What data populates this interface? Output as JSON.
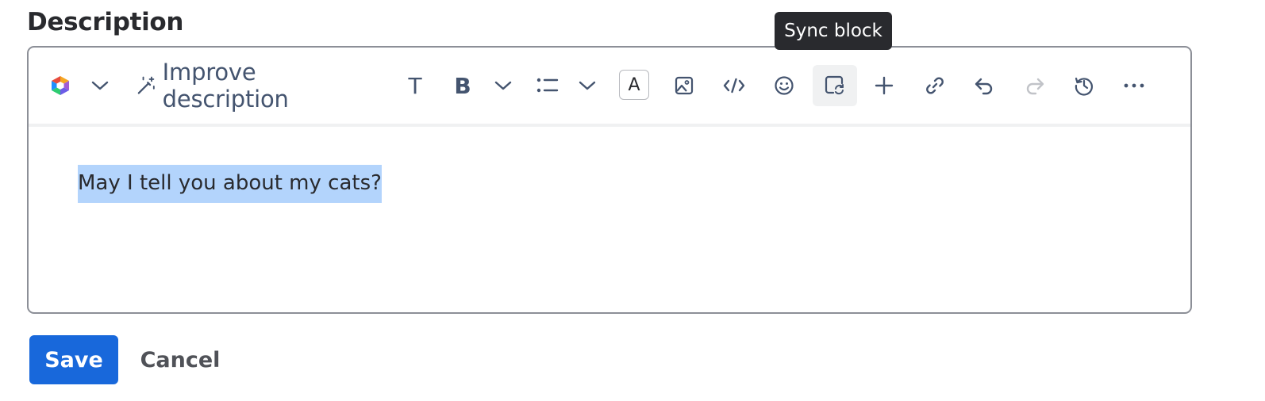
{
  "field": {
    "label": "Description"
  },
  "toolbar": {
    "improve_label": "Improve description",
    "text_style_glyph": "T",
    "bold_glyph": "B",
    "text_color_glyph": "A",
    "items": [
      "ai-logo-icon",
      "chevron-down-icon",
      "magic-wand-icon",
      "text-style-icon",
      "bold-icon",
      "chevron-down-icon",
      "bulleted-list-icon",
      "chevron-down-icon",
      "text-color-icon",
      "image-icon",
      "code-icon",
      "emoji-icon",
      "sync-block-icon",
      "plus-icon",
      "link-icon",
      "undo-icon",
      "redo-icon",
      "history-icon",
      "more-icon"
    ]
  },
  "tooltip": {
    "text": "Sync block"
  },
  "editor": {
    "content": "May I tell you about my cats?"
  },
  "actions": {
    "save_label": "Save",
    "cancel_label": "Cancel"
  },
  "colors": {
    "primary": "#1868db",
    "selection": "#b3d4fc",
    "tooltip_bg": "#292a2e",
    "icon": "#44546f",
    "border": "#8c8f97"
  }
}
